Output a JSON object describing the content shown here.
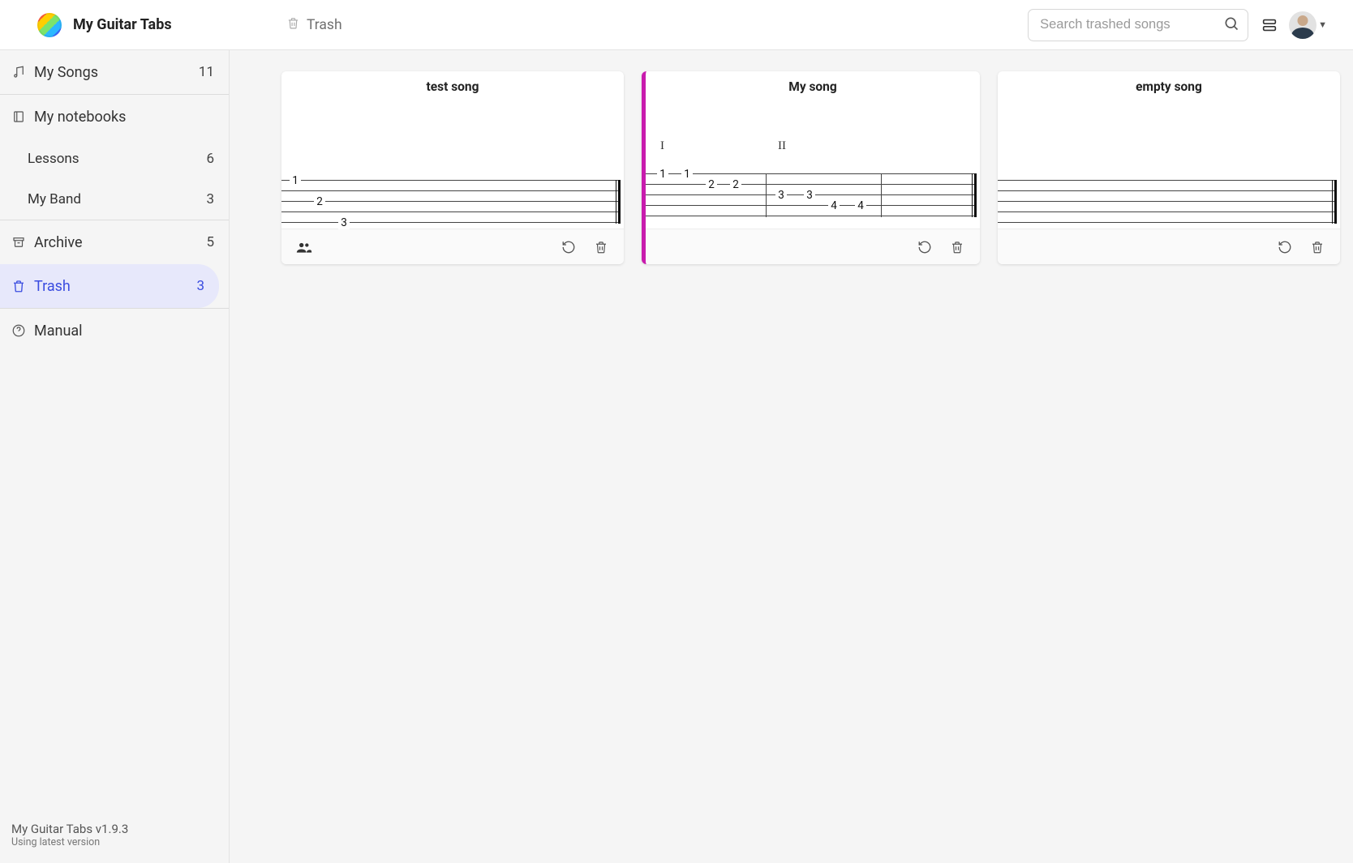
{
  "brand": {
    "title": "My Guitar Tabs"
  },
  "breadcrumb": {
    "label": "Trash"
  },
  "search": {
    "placeholder": "Search trashed songs"
  },
  "sidebar": {
    "mysongs": {
      "label": "My Songs",
      "count": "11"
    },
    "notebooks": {
      "label": "My notebooks"
    },
    "nb": [
      {
        "label": "Lessons",
        "count": "6"
      },
      {
        "label": "My Band",
        "count": "3"
      }
    ],
    "archive": {
      "label": "Archive",
      "count": "5"
    },
    "trash": {
      "label": "Trash",
      "count": "3"
    },
    "manual": {
      "label": "Manual"
    }
  },
  "footer": {
    "version": "My Guitar Tabs v1.9.3",
    "status": "Using latest version"
  },
  "cards": [
    {
      "title": "test song"
    },
    {
      "title": "My song",
      "chords": [
        "I",
        "II"
      ]
    },
    {
      "title": "empty song"
    }
  ]
}
